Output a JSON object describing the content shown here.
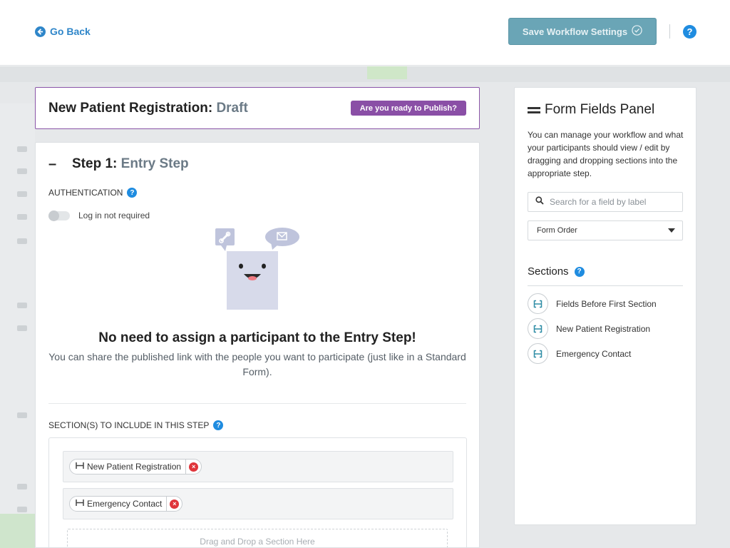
{
  "header": {
    "go_back": "Go Back",
    "save_button": "Save Workflow Settings",
    "help": "?"
  },
  "form": {
    "name": "New Patient Registration:",
    "status": "Draft",
    "publish_button": "Are you ready to Publish?"
  },
  "step": {
    "collapse": "–",
    "title": "Step 1:",
    "subtitle": "Entry Step",
    "auth_label": "AUTHENTICATION",
    "login_toggle": "Log in not required",
    "empty_title": "No need to assign a participant to the Entry Step!",
    "empty_text": "You can share the published link with the people you want to participate (just like in a Standard Form).",
    "sections_label": "SECTION(S) TO INCLUDE IN THIS STEP",
    "included_sections": [
      {
        "label": "New Patient Registration"
      },
      {
        "label": "Emergency Contact"
      }
    ],
    "drop_hint": "Drag and Drop a Section Here"
  },
  "panel": {
    "title": "Form Fields Panel",
    "description": "You can manage your workflow and what your participants should view / edit by dragging and dropping sections into the appropriate step.",
    "search_placeholder": "Search for a field by label",
    "order_select": "Form Order",
    "sections_heading": "Sections",
    "sections": [
      {
        "label": "Fields Before First Section"
      },
      {
        "label": "New Patient Registration"
      },
      {
        "label": "Emergency Contact"
      }
    ]
  },
  "colors": {
    "accent_blue": "#2f86c9",
    "save_button": "#6aa5b6",
    "publish_purple": "#8a4fa6",
    "remove_red": "#e0353b"
  }
}
